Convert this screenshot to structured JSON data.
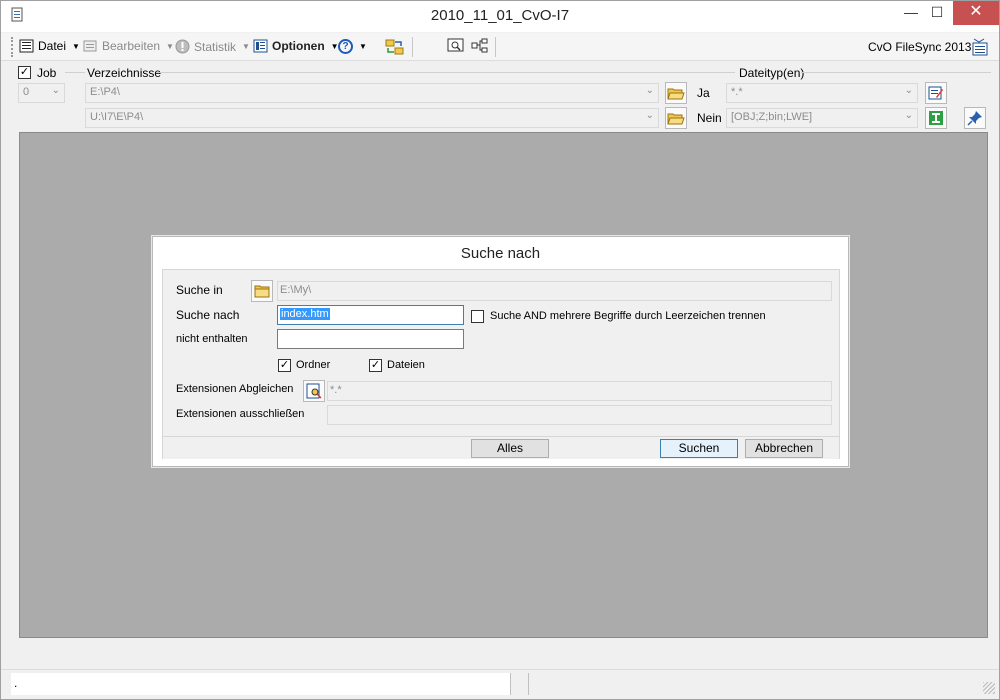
{
  "window": {
    "title": "2010_11_01_CvO-I7",
    "minimize": "—",
    "maximize": "☐",
    "close": "✕"
  },
  "toolbar": {
    "datei": "Datei",
    "bearbeiten": "Bearbeiten",
    "statistik": "Statistik",
    "optionen": "Optionen",
    "help": "?",
    "brand": "CvO FileSync 2013"
  },
  "job": {
    "label": "Job",
    "checked": true,
    "number": "0"
  },
  "verzeichnisse": {
    "label": "Verzeichnisse",
    "path1": "E:\\P4\\",
    "path2": "U:\\I7\\E\\P4\\"
  },
  "dateitypen": {
    "label": "Dateityp(en)",
    "ja_label": "Ja",
    "ja_value": "*.*",
    "nein_label": "Nein",
    "nein_value": "[OBJ;Z;bin;LWE]"
  },
  "dialog": {
    "title": "Suche nach",
    "suche_in_label": "Suche in",
    "suche_in_value": "E:\\My\\",
    "suche_nach_label": "Suche nach",
    "suche_nach_value": "index.htm",
    "and_label": "Suche AND mehrere Begriffe durch Leerzeichen trennen",
    "nicht_enthalten_label": "nicht enthalten",
    "nicht_enthalten_value": "",
    "ordner_label": "Ordner",
    "dateien_label": "Dateien",
    "ext_abgleichen_label": "Extensionen Abgleichen",
    "ext_abgleichen_value": "*.*",
    "ext_ausschliessen_label": "Extensionen ausschließen",
    "ext_ausschliessen_value": "",
    "alles_button": "Alles",
    "suchen_button": "Suchen",
    "abbrechen_button": "Abbrechen"
  },
  "status": {
    "text": "."
  }
}
